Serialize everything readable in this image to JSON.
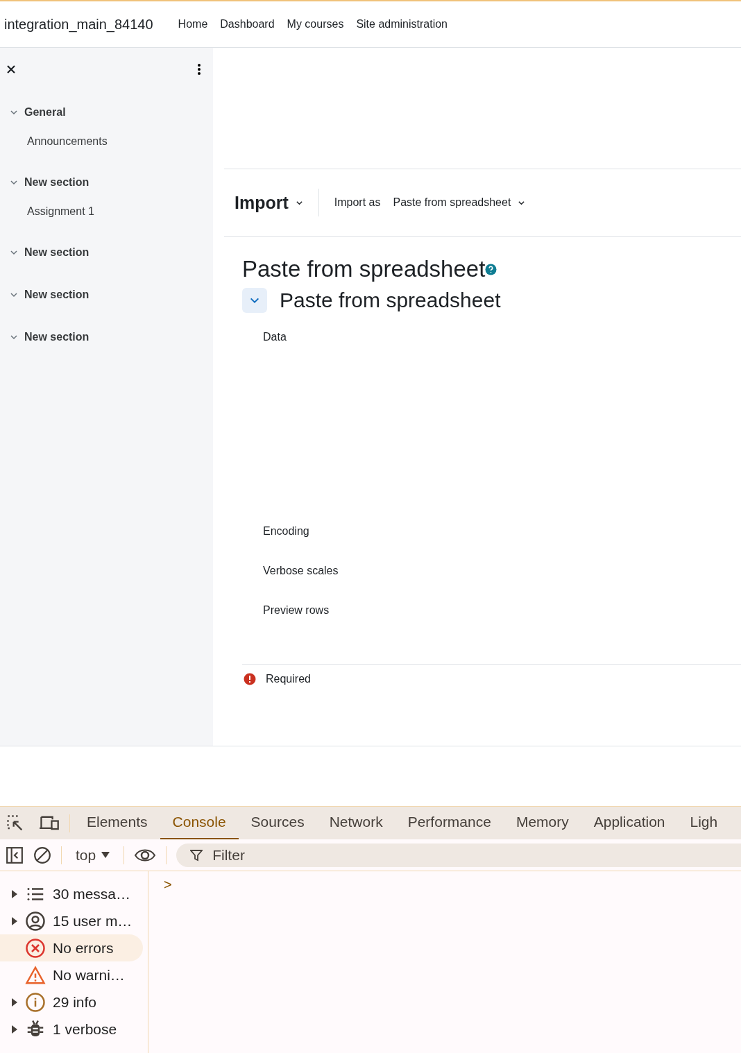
{
  "navbar": {
    "site_name": "integration_main_84140",
    "links": [
      "Home",
      "Dashboard",
      "My courses",
      "Site administration"
    ]
  },
  "course_index": {
    "sections": [
      {
        "title": "General",
        "expanded": true,
        "children": [
          "Announcements"
        ]
      },
      {
        "title": "New section",
        "expanded": true,
        "children": [
          "Assignment 1"
        ]
      },
      {
        "title": "New section",
        "expanded": true
      },
      {
        "title": "New section",
        "expanded": true
      },
      {
        "title": "New section",
        "expanded": true
      }
    ]
  },
  "action_bar": {
    "menu": "Import",
    "import_as_label": "Import as",
    "import_as_value": "Paste from spreadsheet"
  },
  "form": {
    "heading": "Paste from spreadsheet",
    "section": {
      "title": "Paste from spreadsheet",
      "expanded": true
    },
    "fields": [
      {
        "label": "Data",
        "kind": "textarea"
      },
      {
        "label": "Encoding",
        "kind": "select"
      },
      {
        "label": "Verbose scales",
        "kind": "select"
      },
      {
        "label": "Preview rows",
        "kind": "select"
      }
    ],
    "required_note": "Required"
  },
  "devtools": {
    "tabs": [
      {
        "label": "Elements",
        "selected": false
      },
      {
        "label": "Console",
        "selected": true
      },
      {
        "label": "Sources",
        "selected": false
      },
      {
        "label": "Network",
        "selected": false
      },
      {
        "label": "Performance",
        "selected": false
      },
      {
        "label": "Memory",
        "selected": false
      },
      {
        "label": "Application",
        "selected": false
      },
      {
        "label": "Ligh",
        "selected": false
      }
    ],
    "context": "top",
    "filter_placeholder": "Filter",
    "prompt": ">",
    "sidebar": [
      {
        "kind": "messages",
        "label": "30 messa…",
        "expandable": true,
        "selected": false
      },
      {
        "kind": "user",
        "label": "15 user m…",
        "expandable": true,
        "selected": false
      },
      {
        "kind": "errors",
        "label": "No errors",
        "expandable": false,
        "selected": true
      },
      {
        "kind": "warnings",
        "label": "No warni…",
        "expandable": false,
        "selected": false
      },
      {
        "kind": "info",
        "label": "29 info",
        "expandable": true,
        "selected": false
      },
      {
        "kind": "verbose",
        "label": "1 verbose",
        "expandable": true,
        "selected": false
      }
    ]
  }
}
